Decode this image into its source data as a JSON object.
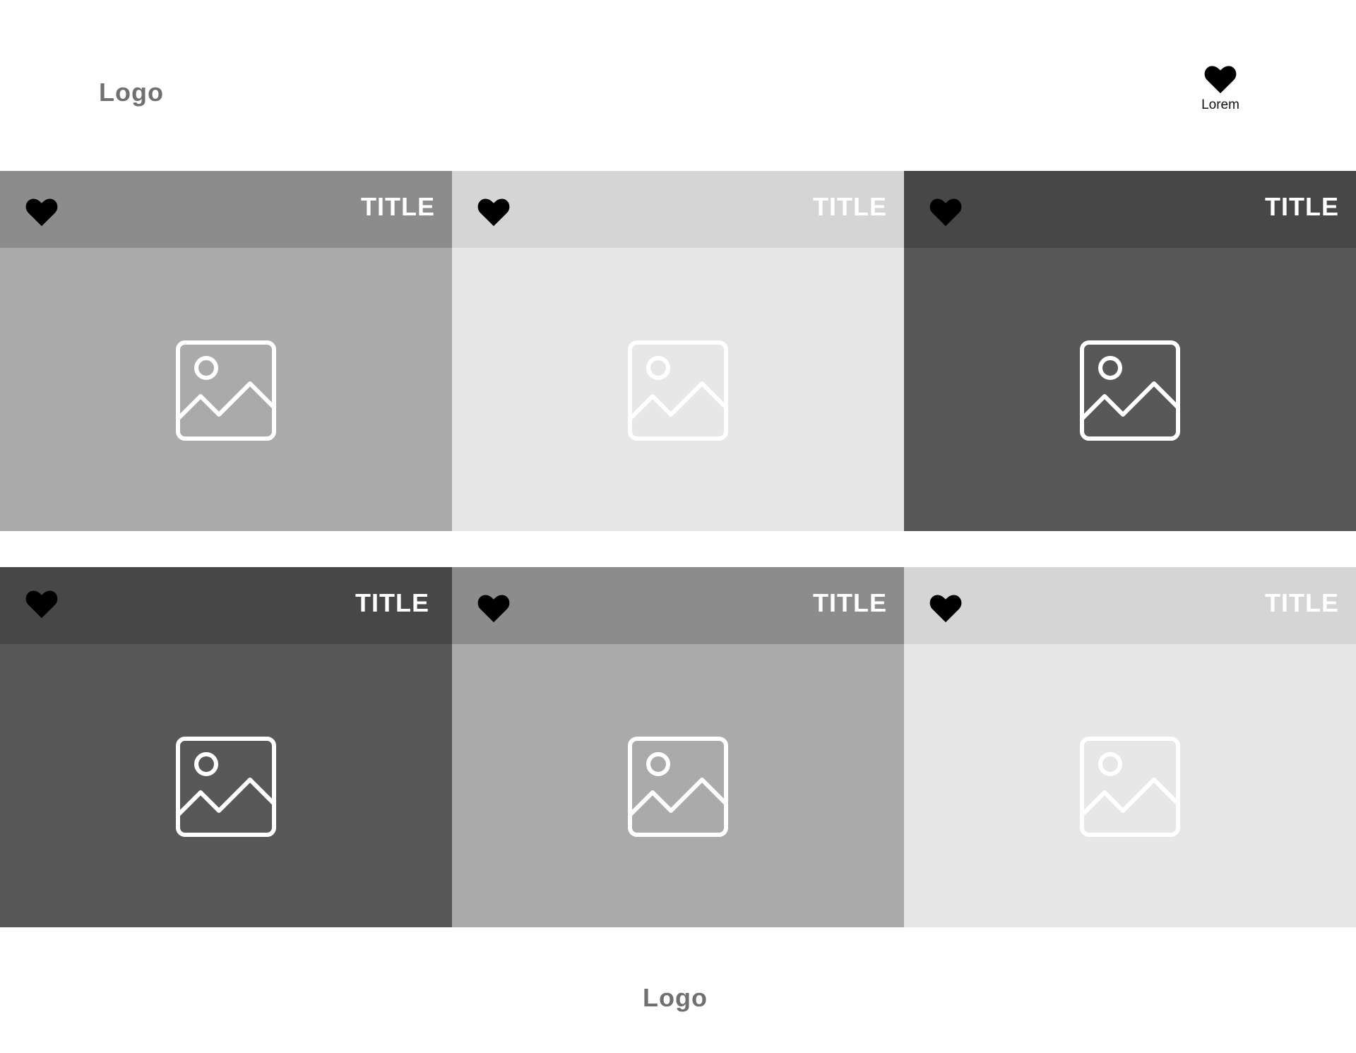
{
  "header": {
    "logo": "Logo",
    "favorites_label": "Lorem"
  },
  "tiles": [
    {
      "title": "TITLE",
      "bar_color": "#8c8c8c",
      "body_color": "#aaaaaa",
      "title_color": "#ffffff",
      "icon_color": "#ffffff"
    },
    {
      "title": "TITLE",
      "bar_color": "#d5d5d5",
      "body_color": "#e7e7e7",
      "title_color": "#ffffff",
      "icon_color": "#ffffff"
    },
    {
      "title": "TITLE",
      "bar_color": "#474747",
      "body_color": "#585858",
      "title_color": "#ffffff",
      "icon_color": "#ffffff"
    },
    {
      "title": "TITLE",
      "bar_color": "#474747",
      "body_color": "#585858",
      "title_color": "#ffffff",
      "icon_color": "#ffffff"
    },
    {
      "title": "TITLE",
      "bar_color": "#8c8c8c",
      "body_color": "#aaaaaa",
      "title_color": "#ffffff",
      "icon_color": "#ffffff"
    },
    {
      "title": "TITLE",
      "bar_color": "#d5d5d5",
      "body_color": "#e7e7e7",
      "title_color": "#ffffff",
      "icon_color": "#ffffff"
    }
  ],
  "footer": {
    "logo": "Logo"
  },
  "icons": {
    "favorite": "heart-icon",
    "placeholder": "image-icon"
  }
}
